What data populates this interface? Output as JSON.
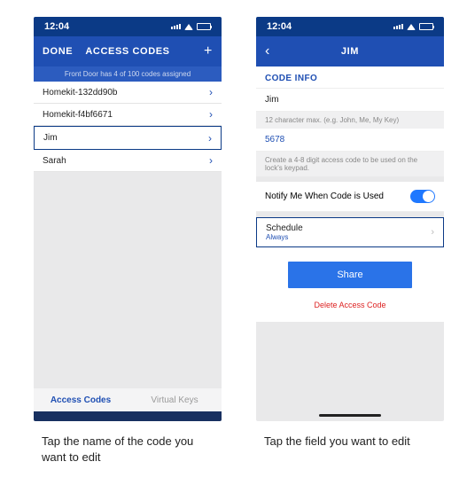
{
  "status": {
    "time": "12:04"
  },
  "left": {
    "nav": {
      "done": "DONE",
      "title": "ACCESS CODES",
      "add": "+"
    },
    "strip": "Front Door has 4 of 100 codes assigned",
    "rows": [
      {
        "label": "Homekit-132dd90b"
      },
      {
        "label": "Homekit-f4bf6671"
      },
      {
        "label": "Jim"
      },
      {
        "label": "Sarah"
      }
    ],
    "tabs": {
      "codes": "Access Codes",
      "keys": "Virtual Keys"
    }
  },
  "right": {
    "nav": {
      "title": "JIM"
    },
    "section": "CODE INFO",
    "name": "Jim",
    "name_hint": "12 character max. (e.g. John, Me, My Key)",
    "code": "5678",
    "code_hint": "Create a 4-8 digit access code to be used on the lock's keypad.",
    "notify": "Notify Me When Code is Used",
    "schedule": {
      "label": "Schedule",
      "value": "Always"
    },
    "share": "Share",
    "delete": "Delete Access Code"
  },
  "captions": {
    "left": "Tap the name of the code you want to edit",
    "right": "Tap the field you want to edit"
  }
}
